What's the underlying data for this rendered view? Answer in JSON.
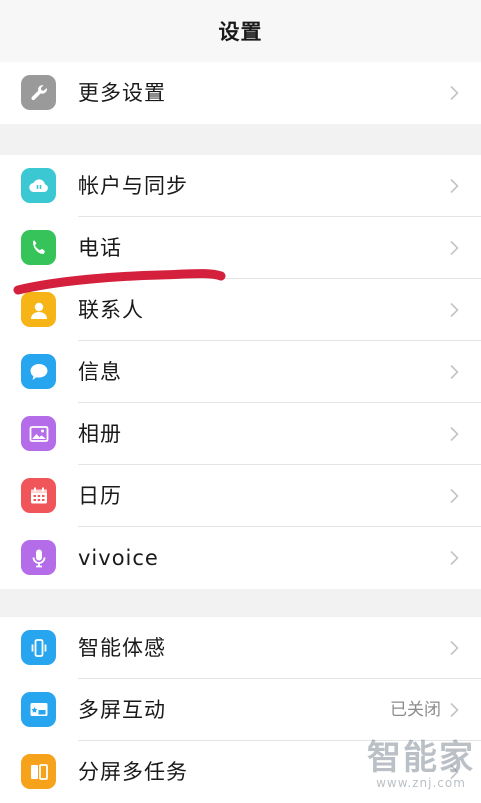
{
  "header": {
    "title": "设置"
  },
  "groups": [
    {
      "items": [
        {
          "label": "更多设置",
          "icon": "wrench-icon",
          "color": "#9a9a9a"
        }
      ]
    },
    {
      "items": [
        {
          "label": "帐户与同步",
          "icon": "cloud-sync-icon",
          "color": "#3cc8d2"
        },
        {
          "label": "电话",
          "icon": "phone-icon",
          "color": "#35c35a"
        },
        {
          "label": "联系人",
          "icon": "contact-person-icon",
          "color": "#f6b416"
        },
        {
          "label": "信息",
          "icon": "chat-bubble-icon",
          "color": "#27a6ef"
        },
        {
          "label": "相册",
          "icon": "photo-icon",
          "color": "#b46ce8"
        },
        {
          "label": "日历",
          "icon": "calendar-icon",
          "color": "#f0555a"
        },
        {
          "label": "vivoice",
          "icon": "microphone-icon",
          "color": "#b46ce8"
        }
      ]
    },
    {
      "items": [
        {
          "label": "智能体感",
          "icon": "motion-phone-icon",
          "color": "#27a6ef"
        },
        {
          "label": "多屏互动",
          "icon": "screen-cast-icon",
          "color": "#27a6ef",
          "value": "已关闭"
        },
        {
          "label": "分屏多任务",
          "icon": "split-screen-icon",
          "color": "#f6a21a"
        }
      ]
    }
  ],
  "watermark": {
    "main": "智能家",
    "sub": "www.znj.com"
  }
}
